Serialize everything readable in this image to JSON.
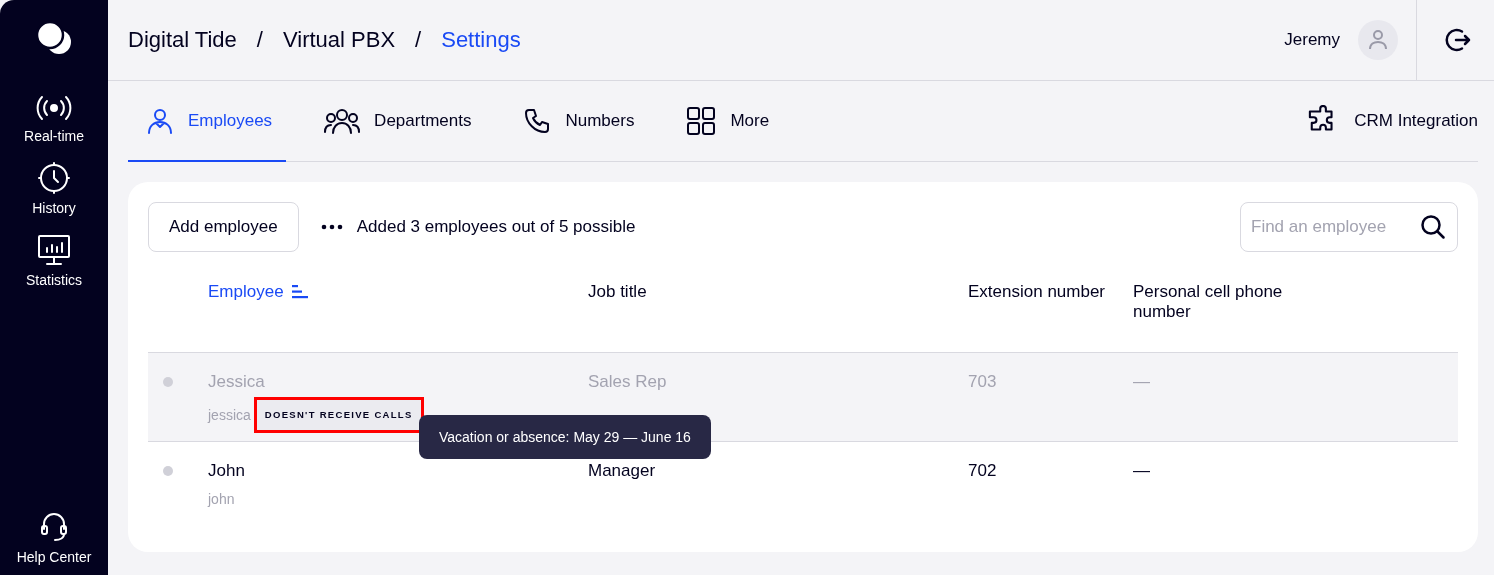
{
  "sidebar": {
    "items": [
      {
        "kind": "realtime",
        "label": "Real-time"
      },
      {
        "kind": "history",
        "label": "History"
      },
      {
        "kind": "statistics",
        "label": "Statistics"
      }
    ],
    "footer": {
      "kind": "help",
      "label": "Help Center"
    }
  },
  "breadcrumbs": [
    {
      "label": "Digital Tide",
      "current": false
    },
    {
      "label": "Virtual PBX",
      "current": false
    },
    {
      "label": "Settings",
      "current": true
    }
  ],
  "breadcrumb_separator": "/",
  "user": {
    "name": "Jeremy"
  },
  "tabs": [
    {
      "kind": "employees",
      "label": "Employees",
      "selected": true
    },
    {
      "kind": "departments",
      "label": "Departments",
      "selected": false
    },
    {
      "kind": "numbers",
      "label": "Numbers",
      "selected": false
    },
    {
      "kind": "more",
      "label": "More",
      "selected": false
    }
  ],
  "crm_link": {
    "label": "CRM Integration"
  },
  "toolbar": {
    "add_button": "Add employee",
    "summary": "Added 3 employees out of 5 possible",
    "search": {
      "placeholder": "Find an employee"
    }
  },
  "table": {
    "columns": [
      {
        "label": "Employee",
        "sorted": true
      },
      {
        "label": "Job title",
        "sorted": false
      },
      {
        "label": "Extension number",
        "sorted": false
      },
      {
        "label": "Personal cell phone number",
        "sorted": false
      }
    ],
    "rows": [
      {
        "name": "Jessica",
        "login": "jessica",
        "badge": {
          "label": "DOESN'T RECEIVE CALLS",
          "highlighted": true
        },
        "job_title": "Sales Rep",
        "extension": "703",
        "cell_phone": "—",
        "inactive": true
      },
      {
        "name": "John",
        "login": "john",
        "job_title": "Manager",
        "extension": "702",
        "cell_phone": "—",
        "inactive": false
      }
    ]
  },
  "tooltip": {
    "text": "Vacation or absence: May 29 — June 16"
  }
}
